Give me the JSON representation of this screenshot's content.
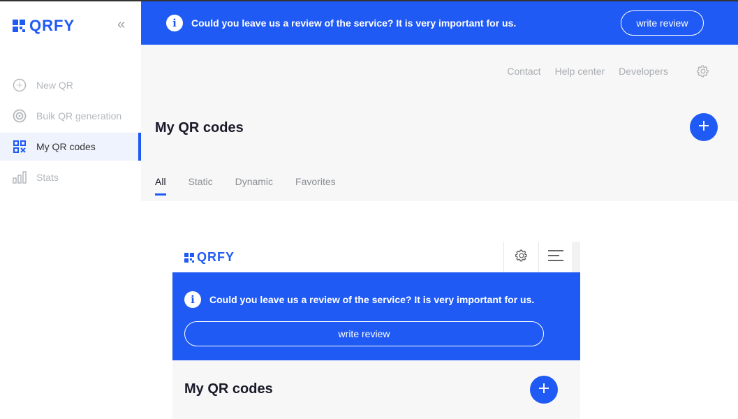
{
  "brand": {
    "name": "QRFY",
    "accent": "#1f5af5"
  },
  "sidebar": {
    "collapse_icon": "double-chevron-left",
    "items": [
      {
        "label": "New QR",
        "icon": "plus-circle-icon",
        "active": false
      },
      {
        "label": "Bulk QR generation",
        "icon": "target-icon",
        "active": false
      },
      {
        "label": "My QR codes",
        "icon": "qr-grid-icon",
        "active": true
      },
      {
        "label": "Stats",
        "icon": "bar-chart-icon",
        "active": false
      }
    ]
  },
  "banner": {
    "message": "Could you leave us a review of the service? It is very important for us.",
    "button_label": "write review"
  },
  "header_links": [
    "Contact",
    "Help center",
    "Developers"
  ],
  "page": {
    "title": "My QR codes",
    "tabs": [
      {
        "label": "All",
        "active": true
      },
      {
        "label": "Static",
        "active": false
      },
      {
        "label": "Dynamic",
        "active": false
      },
      {
        "label": "Favorites",
        "active": false
      }
    ]
  },
  "mobile": {
    "banner_message": "Could you leave us a review of the service? It is very important for us.",
    "button_label": "write review",
    "title": "My QR codes"
  }
}
